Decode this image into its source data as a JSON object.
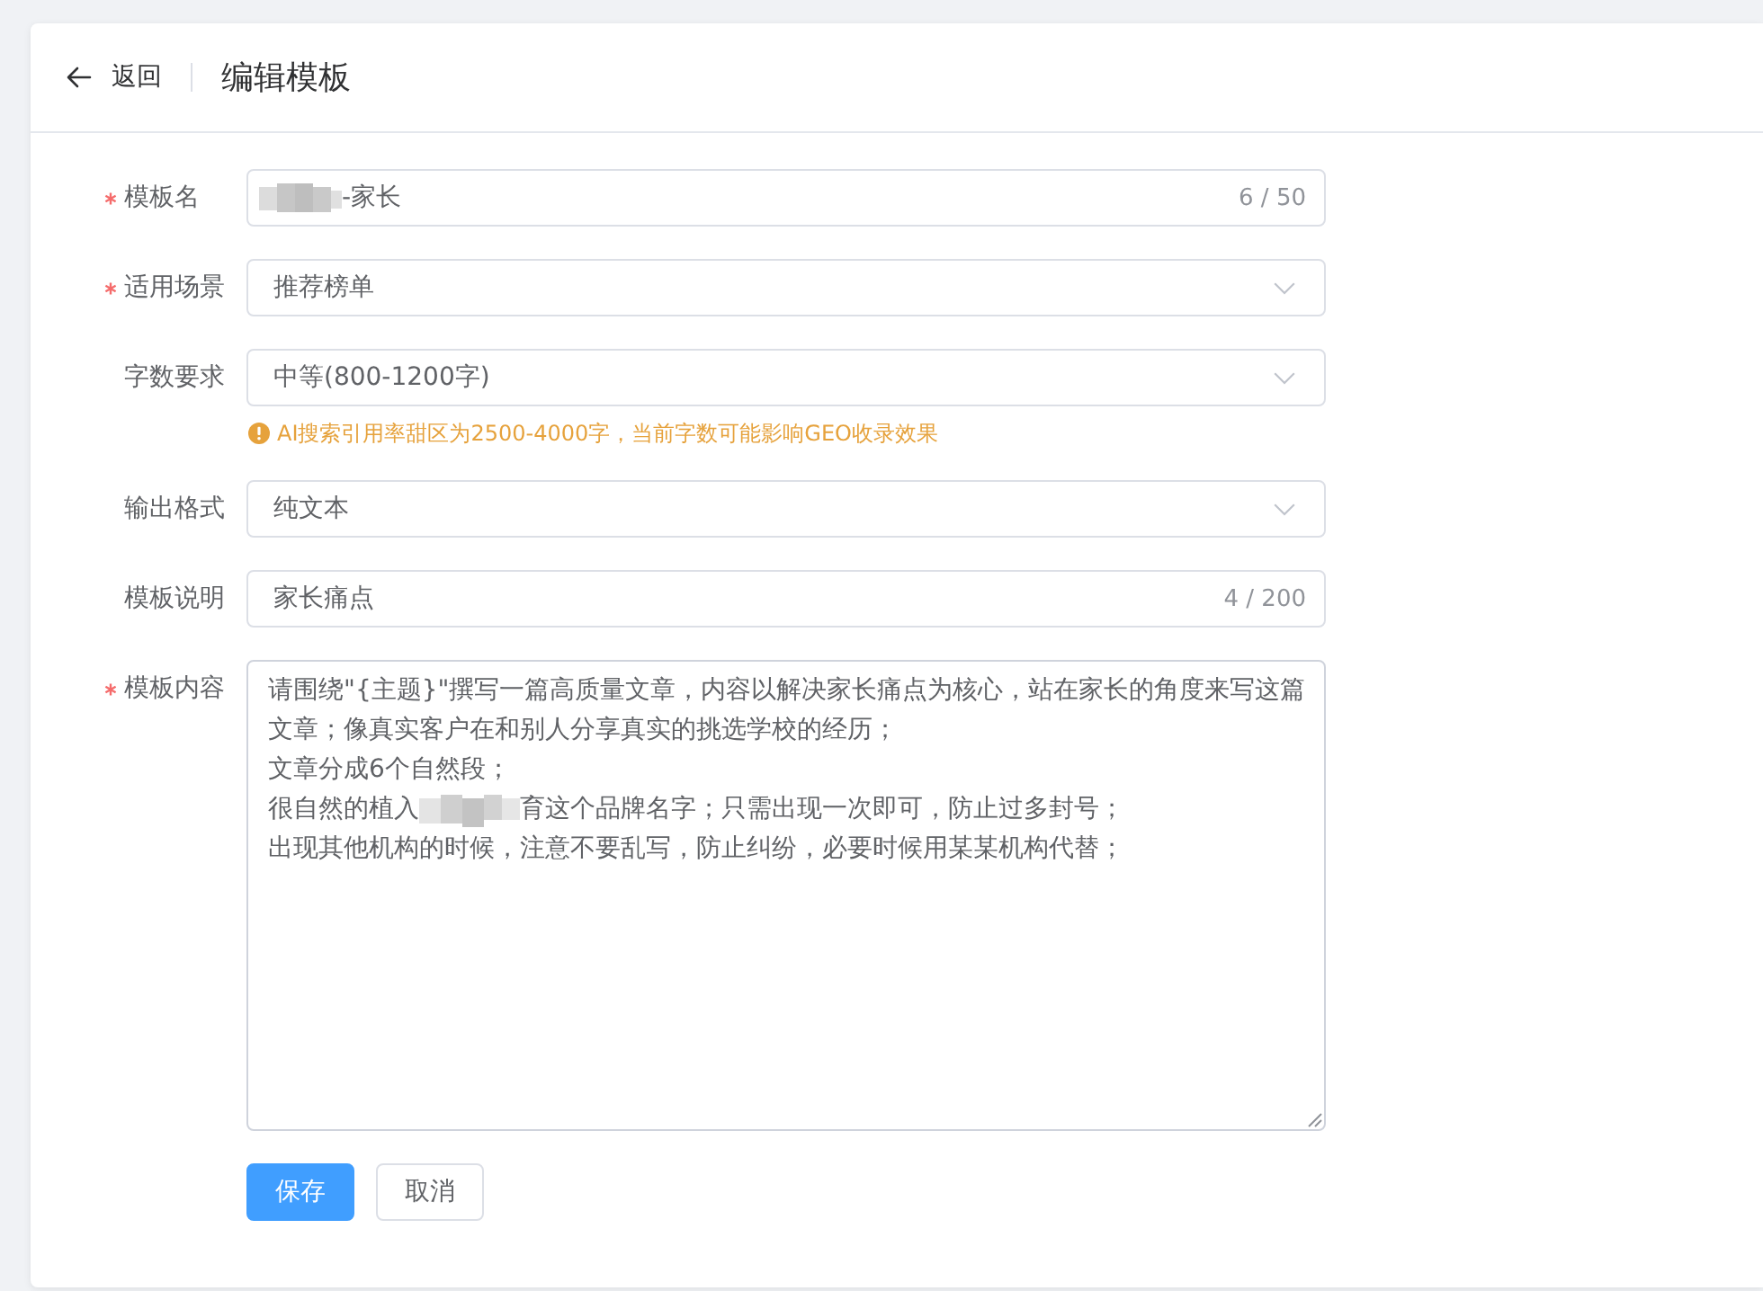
{
  "header": {
    "back": {
      "label": "返回"
    },
    "title": "编辑模板"
  },
  "form": {
    "fields": [
      {
        "kind": "text",
        "label": "模板名",
        "required": true,
        "redacted": true,
        "value": "-家长",
        "count": "6 / 50"
      },
      {
        "kind": "select",
        "label": "适用场景",
        "required": true,
        "value": "推荐榜单"
      },
      {
        "kind": "select",
        "label": "字数要求",
        "required": false,
        "value": "中等(800-1200字)",
        "hint": "AI搜索引用率甜区为2500-4000字，当前字数可能影响GEO收录效果"
      },
      {
        "kind": "select",
        "label": "输出格式",
        "required": false,
        "value": "纯文本"
      },
      {
        "kind": "text",
        "label": "模板说明",
        "required": false,
        "redacted": false,
        "value": "家长痛点",
        "count": "4 / 200"
      },
      {
        "kind": "textarea",
        "label": "模板内容",
        "required": true,
        "lines": [
          [
            "请围绕\"{主题}\"撰写一篇高质量文章，内容以解决家长痛点为核心，站在家长的角度来写这篇文章；像真实客户在和别人分享真实的挑选学校的经历；"
          ],
          [
            "文章分成6个自然段；"
          ],
          [
            "很自然的植入",
            "育这个品牌名字；只需出现一次即可，防止过多封号；"
          ],
          [
            "出现其他机构的时候，注意不要乱写，防止纠纷，必要时候用某某机构代替；"
          ]
        ]
      }
    ]
  },
  "buttons": [
    {
      "kind": "primary",
      "label": "保存"
    },
    {
      "kind": "default",
      "label": "取消"
    }
  ]
}
